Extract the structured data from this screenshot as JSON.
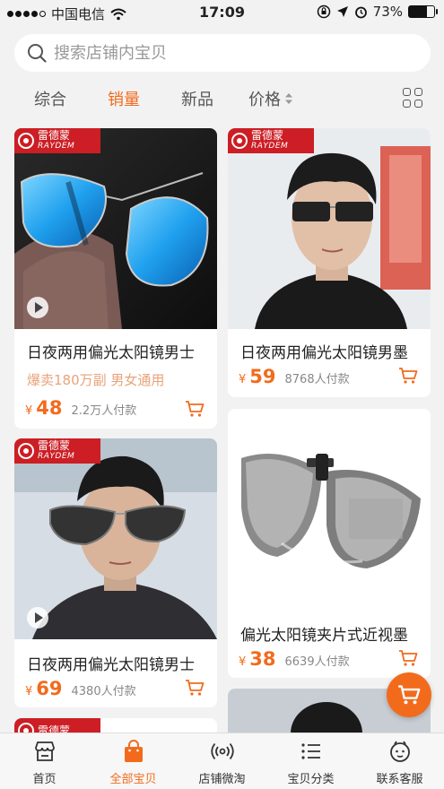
{
  "status": {
    "carrier": "中国电信",
    "time": "17:09",
    "battery": "73%",
    "battery_level": 0.73
  },
  "search": {
    "placeholder": "搜索店铺内宝贝"
  },
  "sort_tabs": [
    {
      "label": "综合",
      "active": false
    },
    {
      "label": "销量",
      "active": true
    },
    {
      "label": "新品",
      "active": false
    },
    {
      "label": "价格",
      "active": false
    }
  ],
  "brand": {
    "cn": "雷德蒙",
    "en": "RAYDEM"
  },
  "products": [
    {
      "title": "日夜两用偏光太阳镜男士",
      "promo": "爆卖180万副 男女通用",
      "currency": "¥",
      "price": "48",
      "sold": "2.2万人付款"
    },
    {
      "title": "日夜两用偏光太阳镜男墨",
      "currency": "¥",
      "price": "59",
      "sold": "8768人付款"
    },
    {
      "title": "日夜两用偏光太阳镜男士",
      "currency": "¥",
      "price": "69",
      "sold": "4380人付款"
    },
    {
      "title": "偏光太阳镜夹片式近视墨",
      "currency": "¥",
      "price": "38",
      "sold": "6639人付款"
    }
  ],
  "tabbar": [
    {
      "label": "首页",
      "icon": "store-icon",
      "active": false
    },
    {
      "label": "全部宝贝",
      "icon": "shopping-bag-icon",
      "active": true
    },
    {
      "label": "店铺微淘",
      "icon": "broadcast-icon",
      "active": false
    },
    {
      "label": "宝贝分类",
      "icon": "list-icon",
      "active": false
    },
    {
      "label": "联系客服",
      "icon": "service-face-icon",
      "active": false
    }
  ],
  "colors": {
    "accent": "#f26b1d",
    "brand_red": "#cc1e24",
    "promo": "#e8a27a"
  }
}
